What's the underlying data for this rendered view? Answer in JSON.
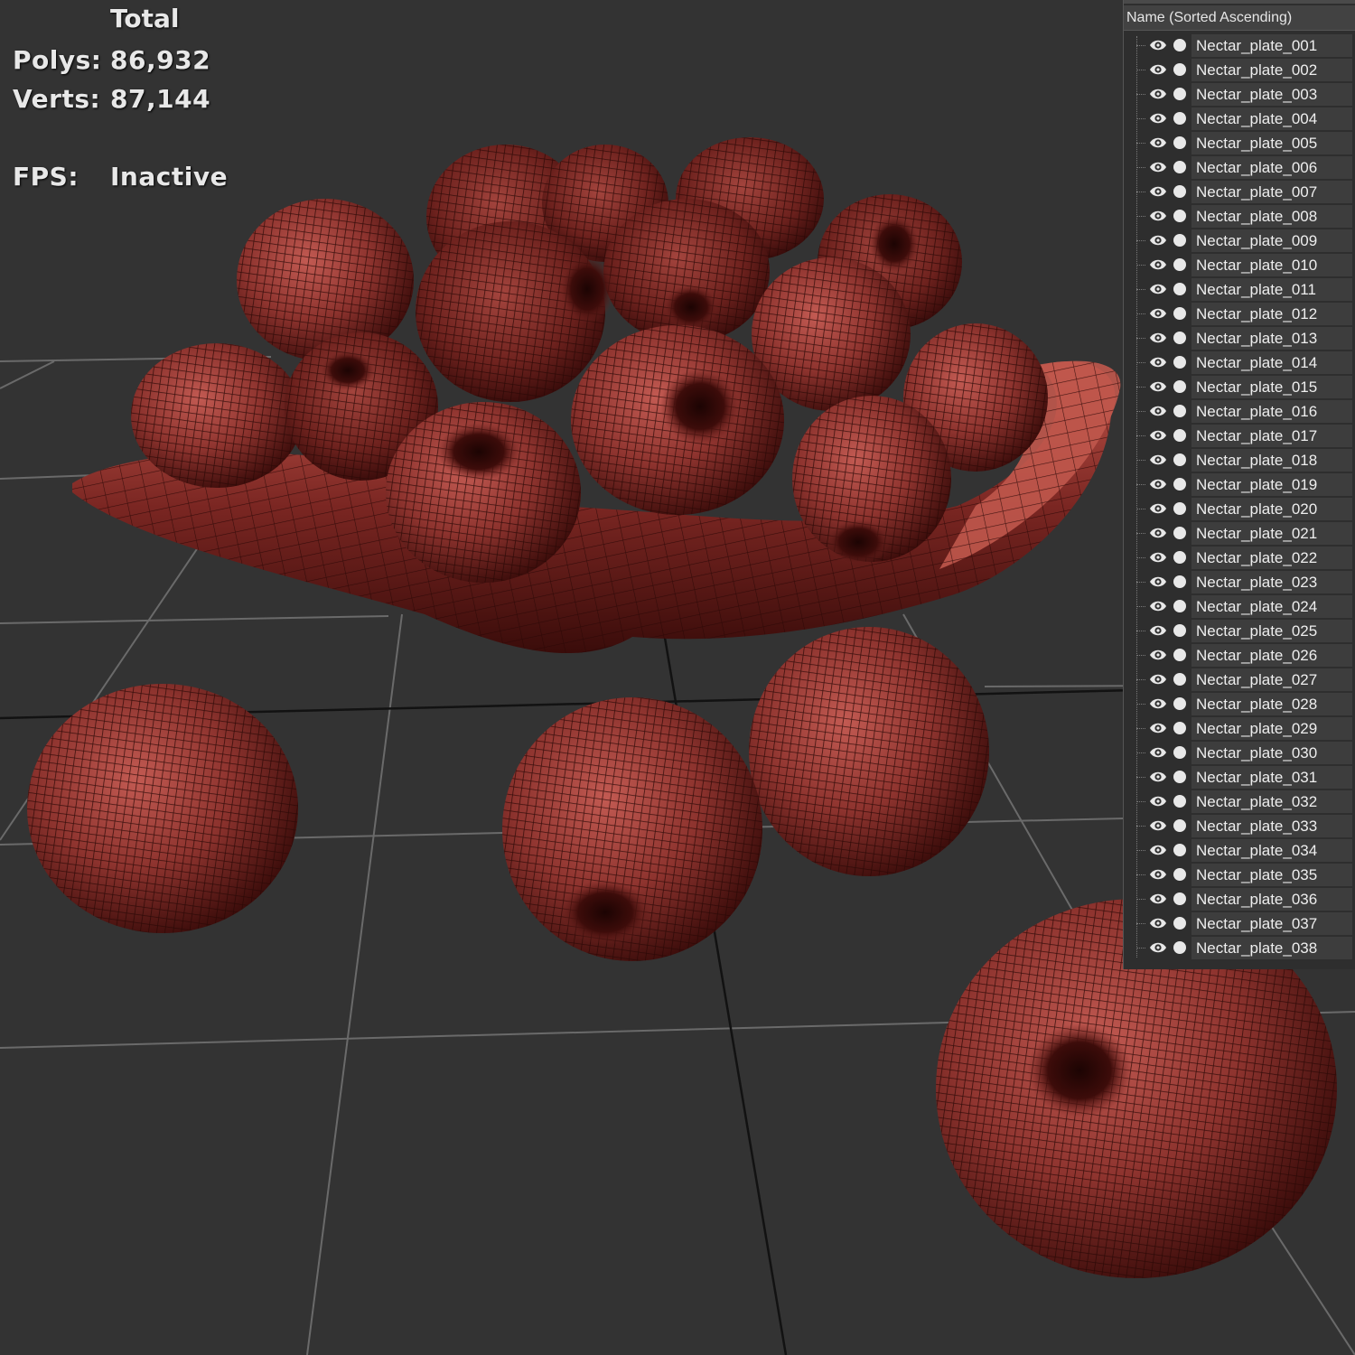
{
  "stats": {
    "column_title": "Total",
    "polys_label": "Polys:",
    "polys_value": "86,932",
    "verts_label": "Verts:",
    "verts_value": "87,144",
    "fps_label": "FPS:",
    "fps_value": "Inactive"
  },
  "explorer": {
    "column_header": "Name (Sorted Ascending)",
    "items": [
      "Nectar_plate_001",
      "Nectar_plate_002",
      "Nectar_plate_003",
      "Nectar_plate_004",
      "Nectar_plate_005",
      "Nectar_plate_006",
      "Nectar_plate_007",
      "Nectar_plate_008",
      "Nectar_plate_009",
      "Nectar_plate_010",
      "Nectar_plate_011",
      "Nectar_plate_012",
      "Nectar_plate_013",
      "Nectar_plate_014",
      "Nectar_plate_015",
      "Nectar_plate_016",
      "Nectar_plate_017",
      "Nectar_plate_018",
      "Nectar_plate_019",
      "Nectar_plate_020",
      "Nectar_plate_021",
      "Nectar_plate_022",
      "Nectar_plate_023",
      "Nectar_plate_024",
      "Nectar_plate_025",
      "Nectar_plate_026",
      "Nectar_plate_027",
      "Nectar_plate_028",
      "Nectar_plate_029",
      "Nectar_plate_030",
      "Nectar_plate_031",
      "Nectar_plate_032",
      "Nectar_plate_033",
      "Nectar_plate_034",
      "Nectar_plate_035",
      "Nectar_plate_036",
      "Nectar_plate_037",
      "Nectar_plate_038"
    ],
    "visibility_icon": "eye-icon",
    "render_icon": "circle-icon"
  },
  "colors": {
    "viewport_bg": "#333333",
    "grid_line": "#6e6e6e",
    "grid_axis": "#111111",
    "model_base": "#8a2f2b",
    "model_highlight": "#c0564e",
    "model_shadow": "#3a0c0a",
    "wire": "#2a0806"
  }
}
